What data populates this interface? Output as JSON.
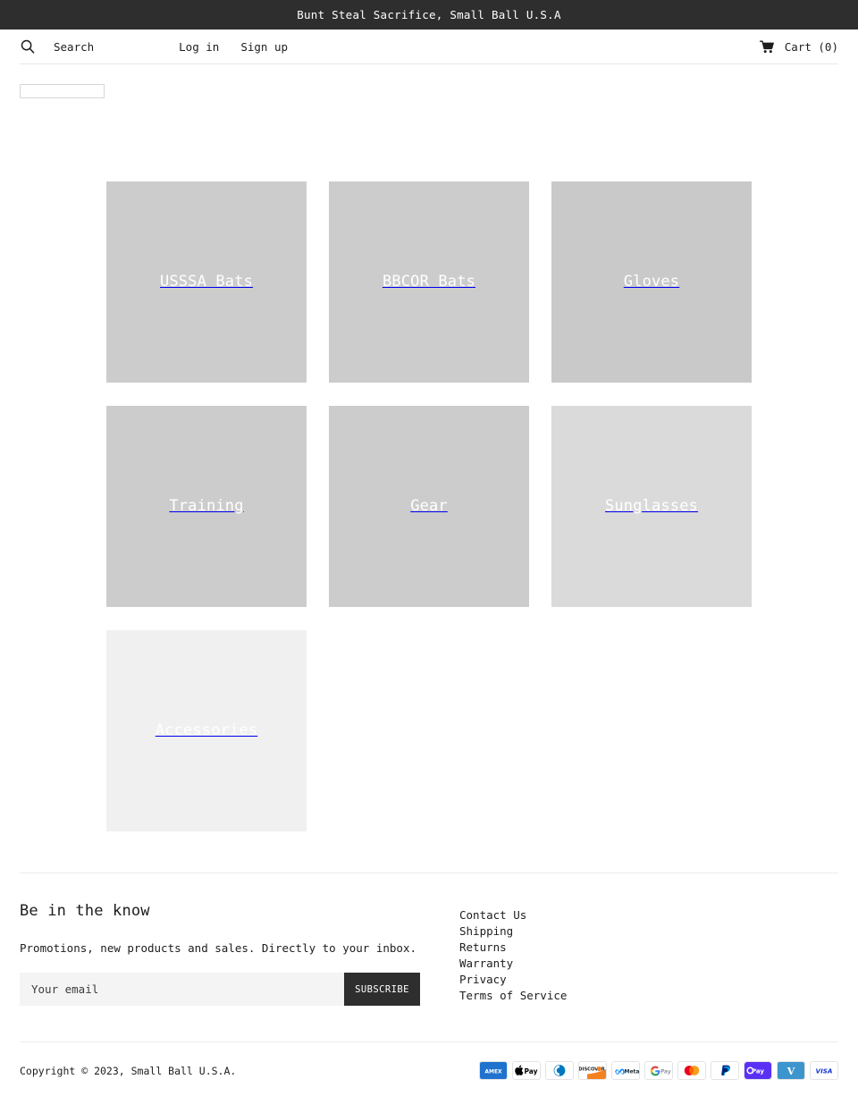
{
  "announcement": {
    "text": "Bunt Steal Sacrifice, Small Ball U.S.A"
  },
  "header": {
    "search_icon": "search-icon",
    "search_label": "Search",
    "nav": [
      {
        "label": "Log in"
      },
      {
        "label": "Sign up"
      }
    ],
    "cart_icon": "shopping-cart-icon",
    "cart_label": "Cart (0)"
  },
  "stray_input": {
    "value": "",
    "placeholder": ""
  },
  "collections": [
    {
      "title": "USSSA Bats",
      "color": "#cccccc"
    },
    {
      "title": "BBCOR Bats",
      "color": "#cccccc"
    },
    {
      "title": "Gloves",
      "color": "#c9c9c9"
    },
    {
      "title": "Training",
      "color": "#cccccc"
    },
    {
      "title": "Gear",
      "color": "#cccccc"
    },
    {
      "title": "Sunglasses",
      "color": "#dadada"
    },
    {
      "title": "Accessories",
      "color": "#f0f0f0"
    }
  ],
  "footer": {
    "heading": "Be in the know",
    "subtext": "Promotions, new products and sales. Directly to your inbox.",
    "email_placeholder": "Your email",
    "email_value": "",
    "subscribe_label": "SUBSCRIBE",
    "links": [
      {
        "label": "Contact Us"
      },
      {
        "label": "Shipping"
      },
      {
        "label": "Returns"
      },
      {
        "label": "Warranty"
      },
      {
        "label": "Privacy"
      },
      {
        "label": "Terms of Service"
      }
    ]
  },
  "bottom": {
    "copyright": "Copyright © 2023, Small Ball U.S.A.",
    "payment_methods": [
      {
        "name": "american-express"
      },
      {
        "name": "apple-pay"
      },
      {
        "name": "diners-club"
      },
      {
        "name": "discover"
      },
      {
        "name": "meta-pay"
      },
      {
        "name": "google-pay"
      },
      {
        "name": "mastercard"
      },
      {
        "name": "paypal"
      },
      {
        "name": "shop-pay"
      },
      {
        "name": "venmo"
      },
      {
        "name": "visa"
      }
    ]
  },
  "colors": {
    "dark": "#2e2e2e",
    "text": "#1c1d1d",
    "rule": "#ececec",
    "field": "#f4f4f4"
  }
}
